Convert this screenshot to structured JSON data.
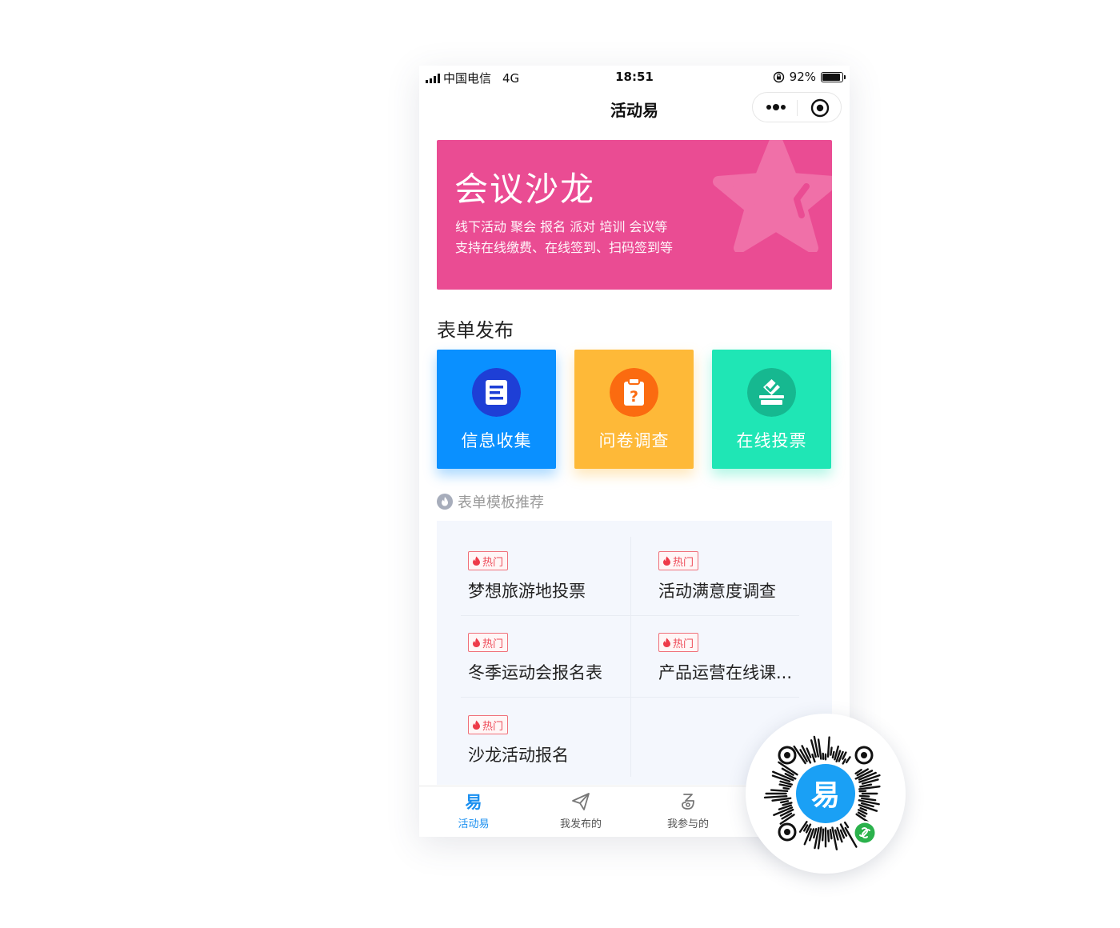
{
  "status_bar": {
    "carrier": "中国电信",
    "network": "4G",
    "time": "18:51",
    "battery": "92%"
  },
  "navbar": {
    "title": "活动易"
  },
  "banner": {
    "title": "会议沙龙",
    "line1": "线下活动 聚会 报名 派对 培训 会议等",
    "line2": "支持在线缴费、在线签到、扫码签到等",
    "color": "#ea4c93"
  },
  "form_section": {
    "title": "表单发布",
    "cards": [
      {
        "label": "信息收集",
        "icon": "document-icon",
        "color": "#0a90ff"
      },
      {
        "label": "问卷调查",
        "icon": "clipboard-question-icon",
        "color": "#feb938"
      },
      {
        "label": "在线投票",
        "icon": "ballot-box-icon",
        "color": "#1fe6b5"
      }
    ]
  },
  "recommend": {
    "title": "表单模板推荐",
    "tag_label": "热门",
    "items": [
      {
        "name": "梦想旅游地投票"
      },
      {
        "name": "活动满意度调查"
      },
      {
        "name": "冬季运动会报名表"
      },
      {
        "name": "产品运营在线课..."
      },
      {
        "name": "沙龙活动报名"
      }
    ]
  },
  "tabbar": {
    "items": [
      {
        "label": "活动易",
        "active": true,
        "icon": "yi-logo-icon"
      },
      {
        "label": "我发布的",
        "active": false,
        "icon": "paper-plane-icon"
      },
      {
        "label": "我参与的",
        "active": false,
        "icon": "participate-icon"
      }
    ]
  },
  "qr_code": {
    "center_char": "易",
    "accent": "#1aa0f5",
    "badge_color": "#2bb24c"
  }
}
